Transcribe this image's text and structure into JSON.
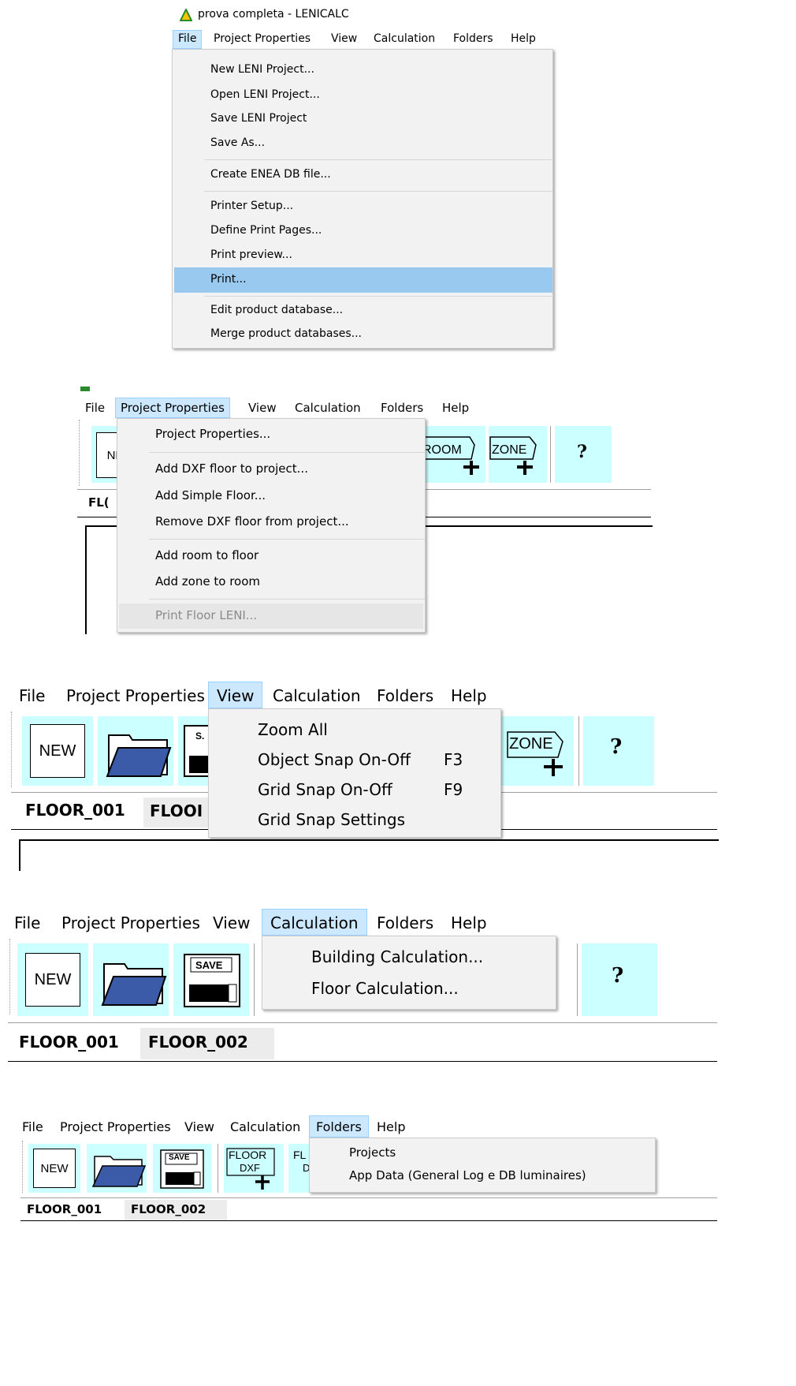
{
  "app_title": "prova completa - LENICALC",
  "menubar": {
    "file": "File",
    "project_properties": "Project Properties",
    "view": "View",
    "calculation": "Calculation",
    "folders": "Folders",
    "help": "Help"
  },
  "file_menu": {
    "new_project": "New LENI Project...",
    "open_project": "Open LENI Project...",
    "save_project": "Save LENI Project",
    "save_as": "Save As...",
    "create_enea": "Create ENEA DB file...",
    "printer_setup": "Printer Setup...",
    "define_pages": "Define Print Pages...",
    "print_preview": "Print preview...",
    "print": "Print...",
    "edit_db": "Edit product database...",
    "merge_db": "Merge product databases..."
  },
  "project_menu": {
    "project_properties": "Project Properties...",
    "add_dxf_floor": "Add DXF floor to project...",
    "add_simple_floor": "Add Simple Floor...",
    "remove_dxf_floor": "Remove DXF floor from project...",
    "add_room": "Add room to floor",
    "add_zone": "Add zone to room",
    "print_floor": "Print Floor LENI..."
  },
  "view_menu": {
    "zoom_all": "Zoom All",
    "object_snap": "Object Snap On-Off",
    "object_snap_key": "F3",
    "grid_snap": "Grid Snap On-Off",
    "grid_snap_key": "F9",
    "grid_settings": "Grid Snap Settings"
  },
  "calc_menu": {
    "building": "Building Calculation...",
    "floor": "Floor Calculation..."
  },
  "folders_menu": {
    "projects": "Projects",
    "app_data": "App Data (General Log e DB luminaires)"
  },
  "toolbar": {
    "new": "NEW",
    "save": "SAVE",
    "save_partial": "S.",
    "new_partial": "NE",
    "room": "ROOM",
    "zone": "ZONE",
    "floor": "FLOOR",
    "dxf": "DXF",
    "floor_partial": "FL",
    "dxf_partial": "D",
    "help_glyph": "?"
  },
  "tabs": {
    "floor1": "FLOOR_001",
    "floor2": "FLOOR_002",
    "floor_partial_a": "FL(",
    "floor_partial_b": "FLOOI"
  },
  "colors": {
    "menu_bg": "#f2f2f2",
    "highlight": "#99c9ef",
    "active_menu": "#cce8ff",
    "toolbar_button": "#ccffff",
    "folder_blue": "#3b5aa8"
  }
}
